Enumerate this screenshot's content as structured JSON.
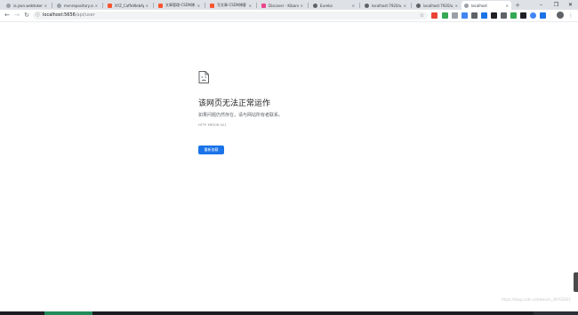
{
  "tabs": [
    {
      "title": "ia.json.webtoken...",
      "favicon": "globe-icon"
    },
    {
      "title": "mvnrepository.co...",
      "favicon": "globe-icon"
    },
    {
      "title": "XYZ_CaffeWebApi...",
      "favicon": "csdn-icon"
    },
    {
      "title": "文章管理-CSDN博...",
      "favicon": "csdn-icon"
    },
    {
      "title": "写文章-CSDN博客",
      "favicon": "csdn-icon"
    },
    {
      "title": "Discover - Kibana",
      "favicon": "kibana-icon"
    },
    {
      "title": "Eureka",
      "favicon": "globe-icon"
    },
    {
      "title": "localhost:7920/u...",
      "favicon": "globe-icon"
    },
    {
      "title": "localhost:7920/u...",
      "favicon": "globe-icon"
    },
    {
      "title": "localhost",
      "favicon": "globe-icon",
      "active": true
    }
  ],
  "window_controls": {
    "minimize": "–",
    "maximize": "❐",
    "close": "✕"
  },
  "address_bar": {
    "host": "localhost:5656",
    "path": "/api/user"
  },
  "error_page": {
    "title": "该网页无法正常运作",
    "description": "如果问题仍然存在，请与网站所有者联系。",
    "error_code": "HTTP ERROR 401",
    "reload_label": "重新加载"
  },
  "watermark": "https://blog.csdn.net/weixin_39702831",
  "colors": {
    "accent": "#1a73e8",
    "tab_strip": "#dee1e6",
    "csdn": "#fc5531"
  }
}
